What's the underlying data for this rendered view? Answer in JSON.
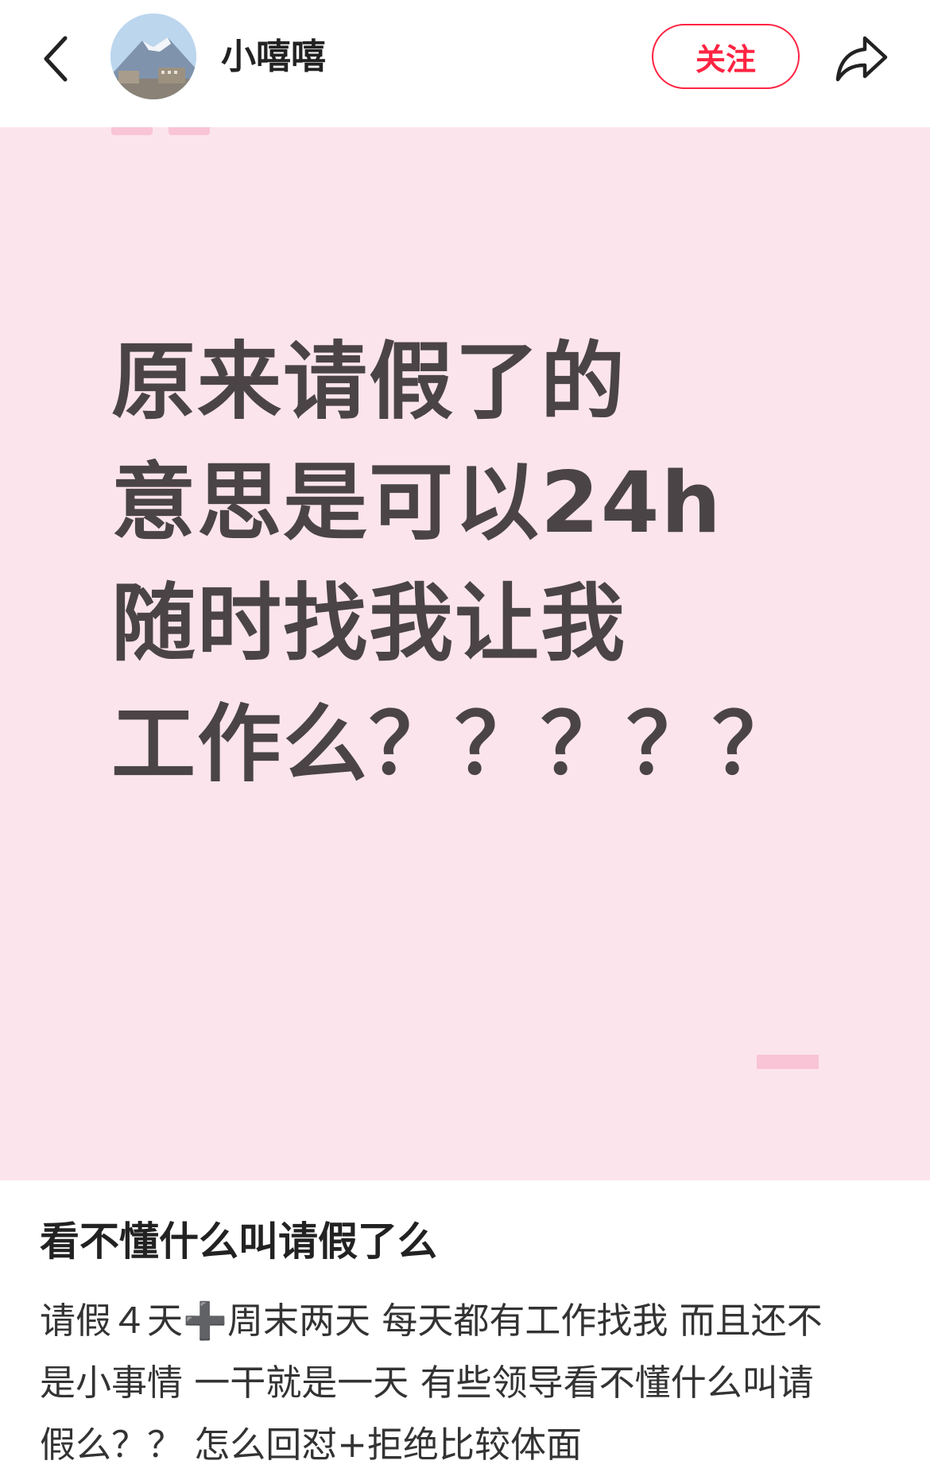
{
  "header": {
    "author_name": "小嘻嘻",
    "follow_label": "关注"
  },
  "image": {
    "lines": [
      "原来请假了的",
      "意思是可以24h",
      "随时找我让我",
      "工作么？？？？？"
    ]
  },
  "post": {
    "title": "看不懂什么叫请假了么",
    "body_lines": [
      "请假４天➕周末两天 每天都有工作找我 而且还不",
      "是小事情 一干就是一天 有些领导看不懂什么叫请",
      "假么？？ 怎么回怼+拒绝比较体面"
    ]
  },
  "colors": {
    "accent": "#ff2442",
    "image_background": "#fce4ec",
    "image_text": "#4a4446"
  },
  "icons": {
    "back": "chevron-left-icon",
    "share": "share-arrow-icon",
    "avatar": "mountain-photo-avatar"
  }
}
